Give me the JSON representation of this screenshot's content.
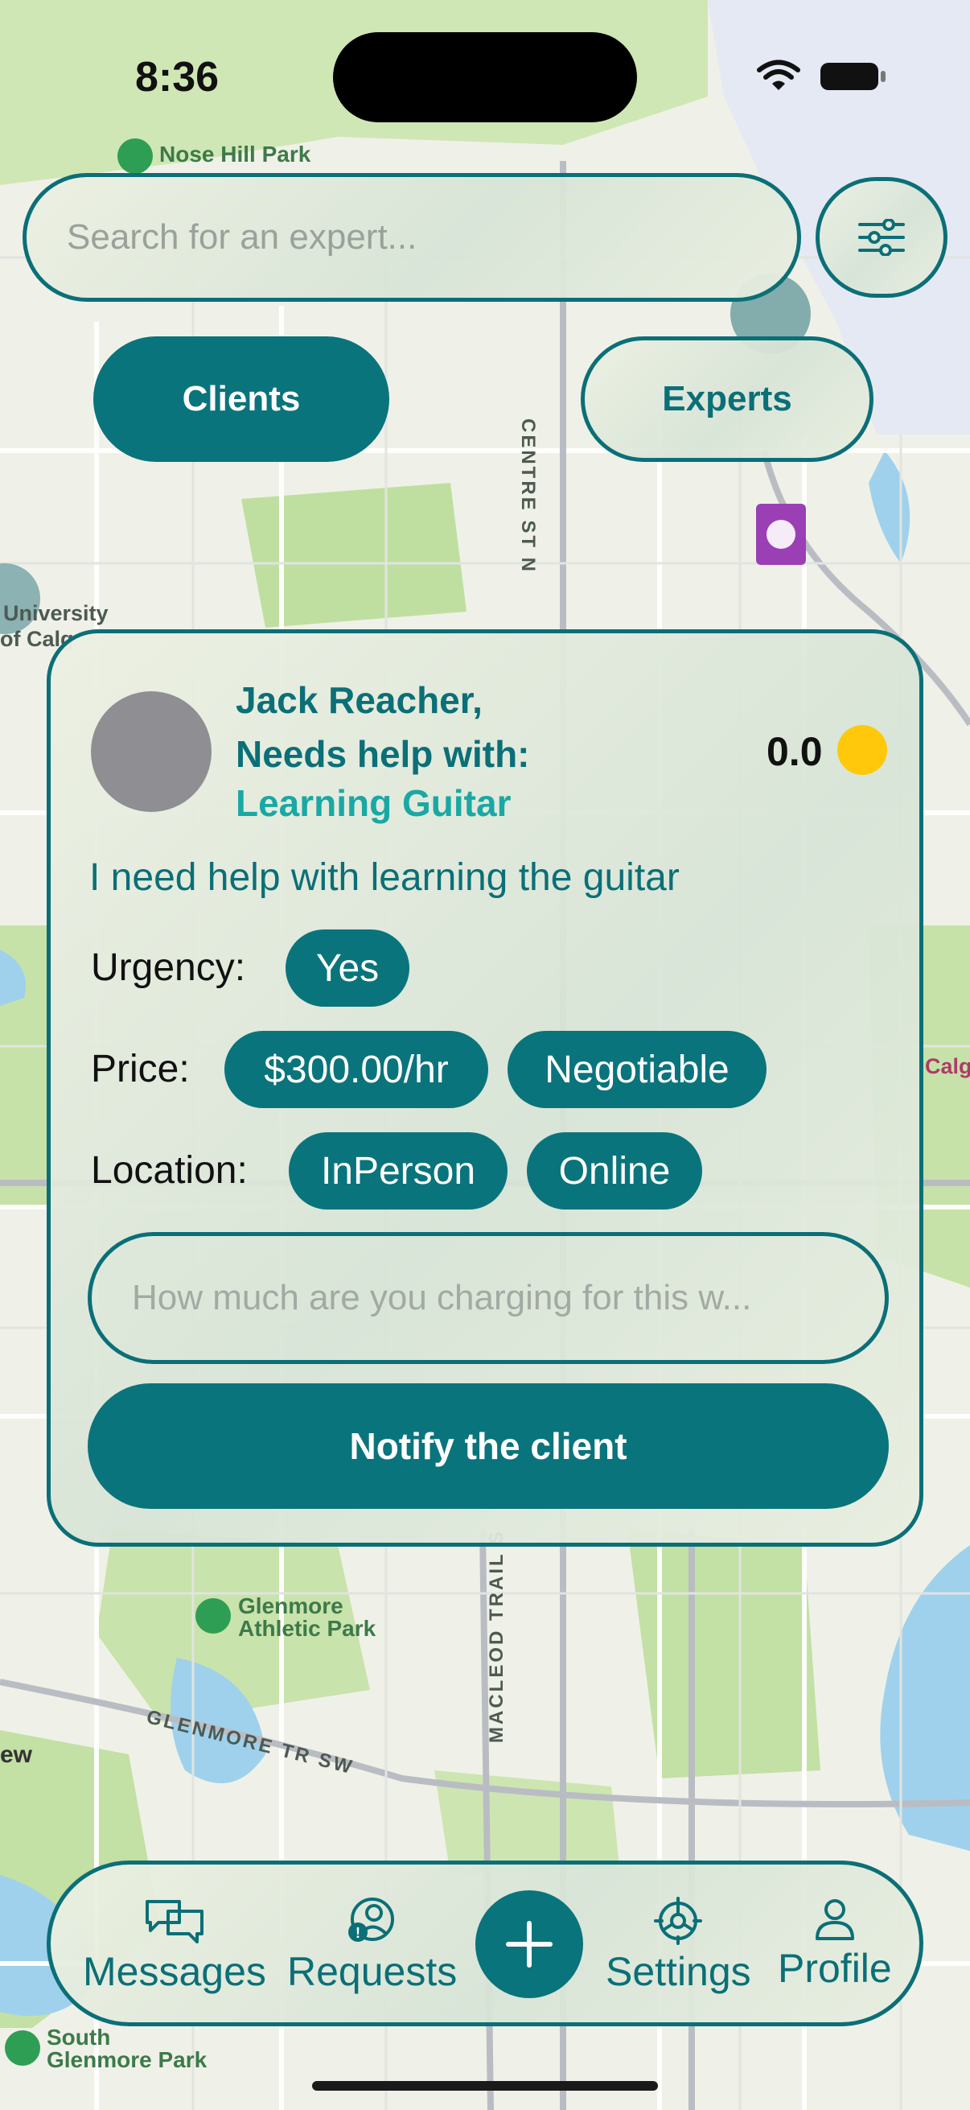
{
  "status": {
    "time": "8:36"
  },
  "search": {
    "placeholder": "Search for an expert..."
  },
  "segment": {
    "clients": "Clients",
    "experts": "Experts"
  },
  "map_labels": {
    "nose_hill_park": "Nose Hill Park",
    "university": "University",
    "university_2": "of Calg",
    "centre_st": "CENTRE ST N",
    "glenmore_athletic_1": "Glenmore",
    "glenmore_athletic_2": "Athletic Park",
    "glenmore_trail": "GLENMORE TR SW",
    "macleod_trail": "MACLEOD TRAIL S",
    "south_glenmore_1": "South",
    "south_glenmore_2": "Glenmore Park",
    "west_label": "ew",
    "calgary_edge": "Calga"
  },
  "request": {
    "name_line": "Jack Reacher,",
    "needs_line": "Needs help with:",
    "topic": "Learning Guitar",
    "rating": "0.0",
    "description": "I need help with learning the guitar",
    "urgency_label": "Urgency:",
    "urgency_value": "Yes",
    "price_label": "Price:",
    "price_value": "$300.00/hr",
    "price_note": "Negotiable",
    "location_label": "Location:",
    "location_values": [
      "InPerson",
      "Online"
    ],
    "charge_placeholder": "How much are you charging for this w...",
    "notify_label": "Notify the client"
  },
  "tabbar": {
    "messages": "Messages",
    "requests": "Requests",
    "settings": "Settings",
    "profile": "Profile"
  },
  "colors": {
    "accent": "#0a747c",
    "topic": "#1aa8a4",
    "coin": "#ffc80a"
  }
}
